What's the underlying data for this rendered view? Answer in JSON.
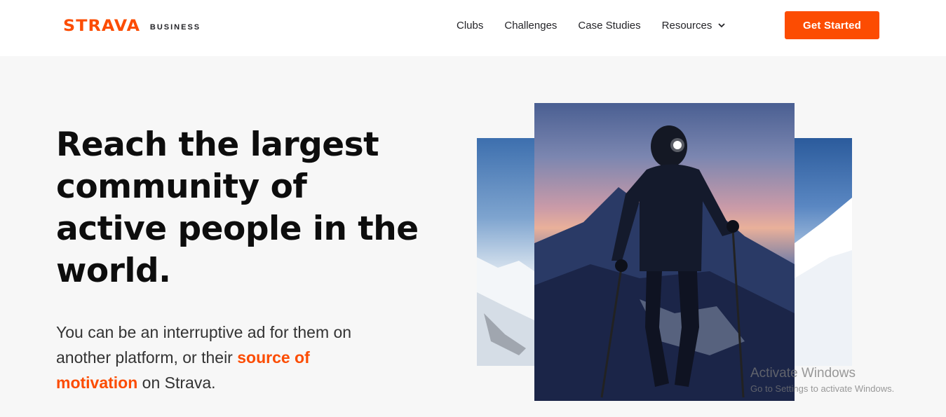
{
  "header": {
    "logo": "STRAVA",
    "logo_sub": "BUSINESS",
    "nav": [
      {
        "label": "Clubs"
      },
      {
        "label": "Challenges"
      },
      {
        "label": "Case Studies"
      },
      {
        "label": "Resources"
      }
    ],
    "cta_label": "Get Started"
  },
  "hero": {
    "title": "Reach the largest community of active people in the world.",
    "text_part1": "You can be an interruptive ad for them on another platform, or their ",
    "text_accent": "source of motivation",
    "text_part2": " on Strava."
  },
  "watermark": {
    "title": "Activate Windows",
    "subtitle": "Go to Settings to activate Windows."
  },
  "colors": {
    "brand": "#fc4c02",
    "page_bg": "#f7f7f7",
    "header_bg": "#ffffff"
  },
  "icons": {
    "resources_dropdown": "chevron-down-icon"
  }
}
